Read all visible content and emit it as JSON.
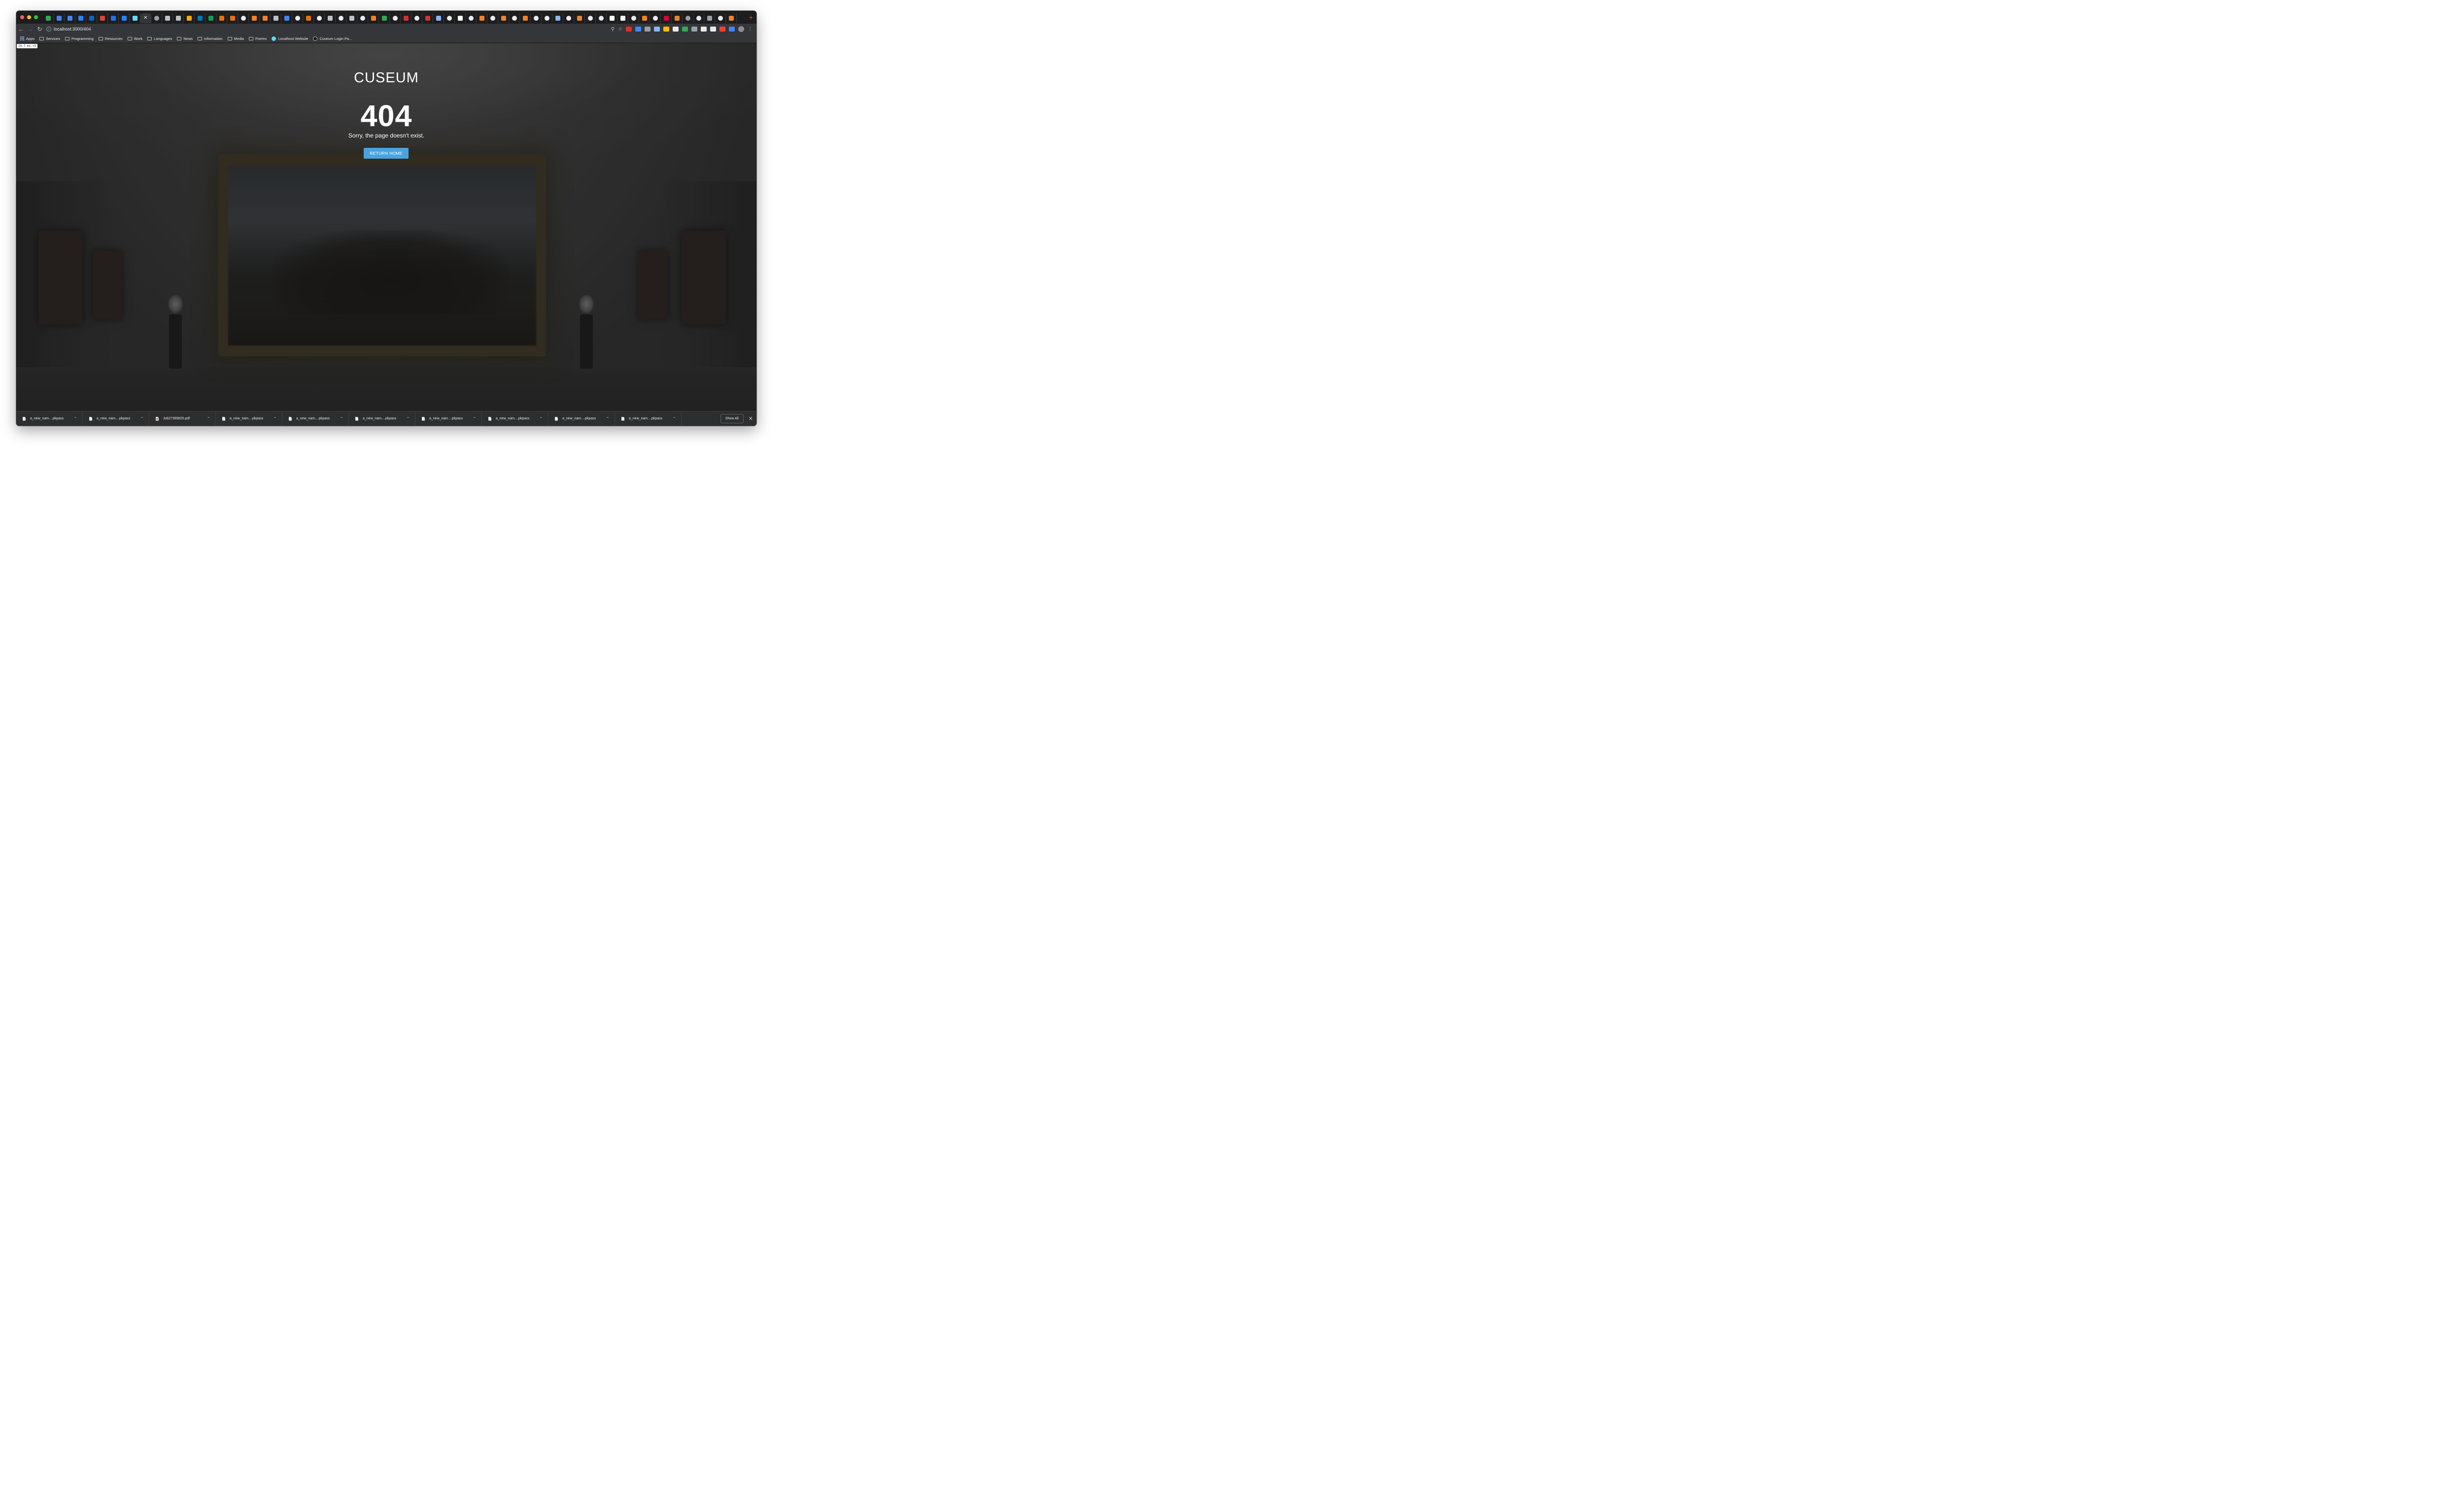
{
  "browser": {
    "tabs": [
      {
        "icon": "maps-icon",
        "color": "#34a853"
      },
      {
        "icon": "calendar-icon",
        "color": "#4285f4"
      },
      {
        "icon": "docs-icon",
        "color": "#4285f4"
      },
      {
        "icon": "jira-icon",
        "color": "#2684ff"
      },
      {
        "icon": "linkedin-icon",
        "color": "#0a66c2"
      },
      {
        "icon": "mail-icon",
        "color": "#d44638"
      },
      {
        "icon": "info-icon",
        "color": "#1a73e8"
      },
      {
        "icon": "diamond-icon",
        "color": "#2684ff"
      },
      {
        "icon": "react-icon",
        "color": "#61dafb"
      },
      {
        "icon": "close-icon",
        "color": "#e8eaed",
        "active": true
      },
      {
        "icon": "globe-icon",
        "color": "#9aa0a6"
      },
      {
        "icon": "apple-icon",
        "color": "#bdc1c6"
      },
      {
        "icon": "apple-icon",
        "color": "#bdc1c6"
      },
      {
        "icon": "notes-icon",
        "color": "#f9ab00"
      },
      {
        "icon": "trello-icon",
        "color": "#0079bf"
      },
      {
        "icon": "sheets-icon",
        "color": "#0f9d58"
      },
      {
        "icon": "terminal-icon",
        "color": "#e8710a"
      },
      {
        "icon": "terminal-icon",
        "color": "#e8710a"
      },
      {
        "icon": "google-icon",
        "color": "#e8eaed"
      },
      {
        "icon": "stack-icon",
        "color": "#f48024"
      },
      {
        "icon": "stack-icon",
        "color": "#f48024"
      },
      {
        "icon": "apple-icon",
        "color": "#bdc1c6"
      },
      {
        "icon": "home-icon",
        "color": "#4285f4"
      },
      {
        "icon": "google-icon",
        "color": "#e8eaed"
      },
      {
        "icon": "code-icon",
        "color": "#e8710a"
      },
      {
        "icon": "google-icon",
        "color": "#e8eaed"
      },
      {
        "icon": "apple-icon",
        "color": "#bdc1c6"
      },
      {
        "icon": "google-icon",
        "color": "#e8eaed"
      },
      {
        "icon": "apple-icon",
        "color": "#bdc1c6"
      },
      {
        "icon": "google-icon",
        "color": "#e8eaed"
      },
      {
        "icon": "stack-icon",
        "color": "#f48024"
      },
      {
        "icon": "tag-icon",
        "color": "#34a853"
      },
      {
        "icon": "google-icon",
        "color": "#e8eaed"
      },
      {
        "icon": "ruby-icon",
        "color": "#cc342d"
      },
      {
        "icon": "google-icon",
        "color": "#e8eaed"
      },
      {
        "icon": "ruby-icon",
        "color": "#cc342d"
      },
      {
        "icon": "feather-icon",
        "color": "#8ab4f8"
      },
      {
        "icon": "google-icon",
        "color": "#e8eaed"
      },
      {
        "icon": "medium-icon",
        "color": "#ffffff"
      },
      {
        "icon": "google-icon",
        "color": "#e8eaed"
      },
      {
        "icon": "stack-icon",
        "color": "#f48024"
      },
      {
        "icon": "google-icon",
        "color": "#e8eaed"
      },
      {
        "icon": "stack-icon",
        "color": "#f48024"
      },
      {
        "icon": "google-icon",
        "color": "#e8eaed"
      },
      {
        "icon": "stack-icon",
        "color": "#f48024"
      },
      {
        "icon": "google-icon",
        "color": "#e8eaed"
      },
      {
        "icon": "google-icon",
        "color": "#e8eaed"
      },
      {
        "icon": "code-icon",
        "color": "#8ab4f8"
      },
      {
        "icon": "google-icon",
        "color": "#e8eaed"
      },
      {
        "icon": "stack-icon",
        "color": "#f48024"
      },
      {
        "icon": "google-icon",
        "color": "#e8eaed"
      },
      {
        "icon": "google-icon",
        "color": "#e8eaed"
      },
      {
        "icon": "medium-icon",
        "color": "#ffffff"
      },
      {
        "icon": "github-icon",
        "color": "#ffffff"
      },
      {
        "icon": "google-icon",
        "color": "#e8eaed"
      },
      {
        "icon": "stack-icon",
        "color": "#f48024"
      },
      {
        "icon": "google-icon",
        "color": "#e8eaed"
      },
      {
        "icon": "angular-icon",
        "color": "#dd0031"
      },
      {
        "icon": "stack-icon",
        "color": "#f48024"
      },
      {
        "icon": "globe-icon",
        "color": "#9aa0a6"
      },
      {
        "icon": "google-icon",
        "color": "#e8eaed"
      },
      {
        "icon": "window-icon",
        "color": "#9aa0a6"
      },
      {
        "icon": "google-icon",
        "color": "#e8eaed"
      },
      {
        "icon": "stack-icon",
        "color": "#f48024"
      }
    ],
    "new_tab_label": "+",
    "url": "localhost:3000/404",
    "extensions": [
      {
        "icon": "adblock-icon",
        "color": "#d93025"
      },
      {
        "icon": "translate-icon",
        "color": "#4285f4"
      },
      {
        "icon": "wallet-icon",
        "color": "#9aa0a6"
      },
      {
        "icon": "shield-icon",
        "color": "#8ab4f8"
      },
      {
        "icon": "pen-icon",
        "color": "#fbbc04"
      },
      {
        "icon": "laptop-icon",
        "color": "#e8eaed"
      },
      {
        "icon": "sync-icon",
        "color": "#34a853"
      },
      {
        "icon": "eyedropper-icon",
        "color": "#9aa0a6"
      },
      {
        "icon": "crop-icon",
        "color": "#e8eaed"
      },
      {
        "icon": "note-icon",
        "color": "#e8eaed"
      },
      {
        "icon": "grid-icon",
        "color": "#ea4335"
      },
      {
        "icon": "ticket-icon",
        "color": "#4285f4"
      }
    ]
  },
  "bookmarks": {
    "apps_label": "Apps",
    "folders": [
      "Services",
      "Programming",
      "Resources",
      "Work",
      "Languages",
      "News",
      "Information",
      "Media",
      "Poems"
    ],
    "links": [
      {
        "label": "Localhost Website",
        "icon": "react-icon"
      },
      {
        "label": "Cuseum Login Pa...",
        "icon": "cuseum-icon"
      }
    ]
  },
  "page": {
    "perf_badge": "19.7 ms ×5",
    "brand": "CUSEUM",
    "error_code": "404",
    "message": "Sorry, the page doesn't exist.",
    "button_label": "RETURN HOME",
    "accent_color": "#4aa3df"
  },
  "downloads": {
    "items": [
      {
        "name": "a_new_nam....pkpass",
        "type": "file"
      },
      {
        "name": "a_new_nam....pkpass",
        "type": "file"
      },
      {
        "name": "Job27389825.pdf",
        "type": "pdf"
      },
      {
        "name": "a_new_nam....pkpass",
        "type": "file"
      },
      {
        "name": "a_new_nam....pkpass",
        "type": "file"
      },
      {
        "name": "a_new_nam....pkpass",
        "type": "file"
      },
      {
        "name": "a_new_nam....pkpass",
        "type": "file"
      },
      {
        "name": "a_new_nam....pkpass",
        "type": "file"
      },
      {
        "name": "a_new_nam....pkpass",
        "type": "file"
      },
      {
        "name": "a_new_nam....pkpass",
        "type": "file"
      }
    ],
    "show_all_label": "Show All"
  }
}
